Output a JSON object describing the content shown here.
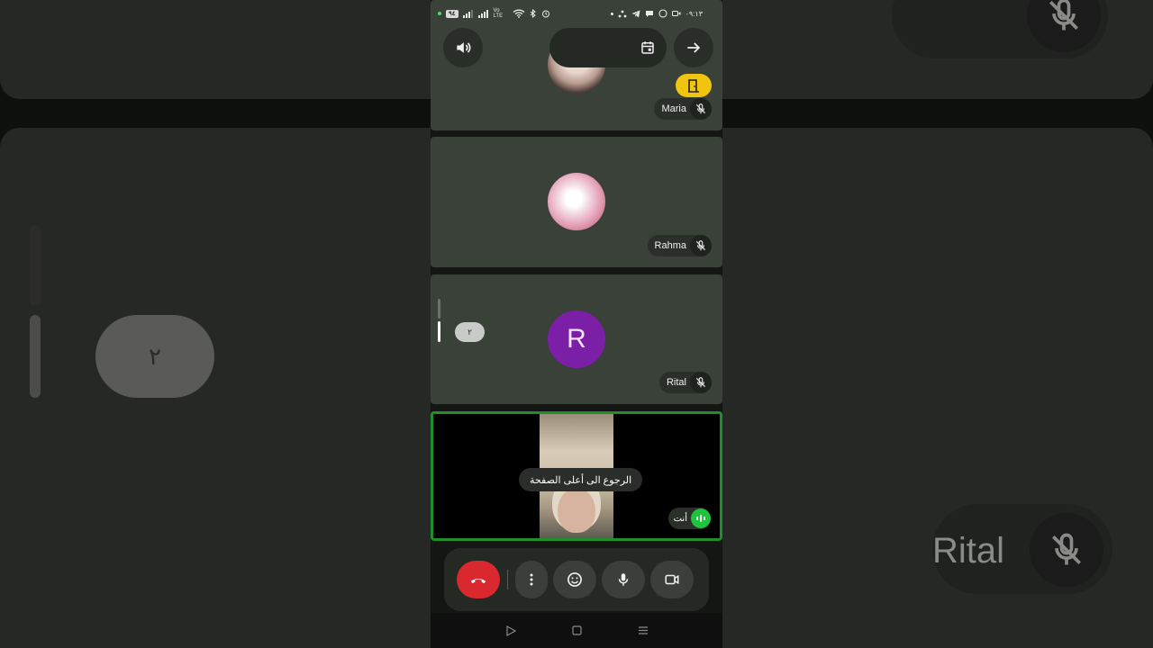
{
  "status_bar": {
    "time": "٠٩:١٣",
    "battery": "٩٤",
    "network": "Vo LTE"
  },
  "participants": [
    {
      "name": "Maria",
      "muted": true
    },
    {
      "name": "Rahma",
      "muted": true
    },
    {
      "name": "Rital",
      "muted": true,
      "initial": "R"
    }
  ],
  "self": {
    "label": "أنت",
    "speaking": true
  },
  "pager": {
    "badge": "٢"
  },
  "tooltip": "الرجوع الى أعلى الصفحة",
  "background": {
    "chip_rahma": "Rahma",
    "chip_rital": "Rital",
    "pill": "٢"
  },
  "colors": {
    "hangup": "#d9282e",
    "speaking": "#20c33e",
    "self_border": "#1f8f2c",
    "rital_avatar": "#7a1fa6",
    "door_button": "#f1c40f"
  },
  "controls": [
    {
      "name": "hang-up",
      "icon": "phone-hangup-icon"
    },
    {
      "name": "more-options",
      "icon": "more-vertical-icon"
    },
    {
      "name": "reactions",
      "icon": "emoji-icon"
    },
    {
      "name": "microphone",
      "icon": "mic-icon"
    },
    {
      "name": "camera",
      "icon": "videocam-icon"
    }
  ]
}
